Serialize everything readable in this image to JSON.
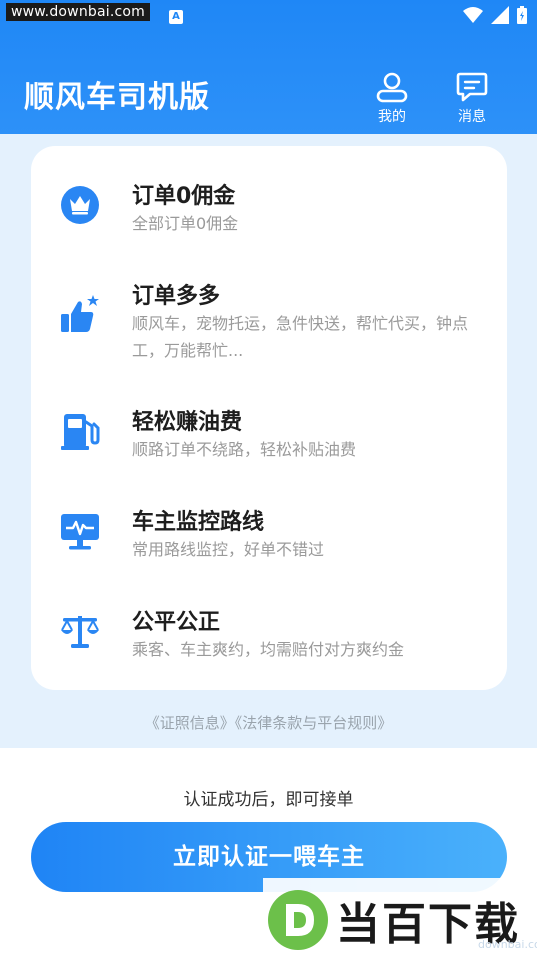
{
  "status_bar": {
    "watermark_url": "www.downbai.com",
    "badge": "A"
  },
  "header": {
    "title": "顺风车司机版",
    "mine_label": "我的",
    "messages_label": "消息"
  },
  "features": [
    {
      "title": "订单0佣金",
      "desc": "全部订单0佣金",
      "icon": "crown-icon"
    },
    {
      "title": "订单多多",
      "desc": "顺风车，宠物托运，急件快送，帮忙代买，钟点工，万能帮忙...",
      "icon": "thumbs-up-star-icon"
    },
    {
      "title": "轻松赚油费",
      "desc": "顺路订单不绕路，轻松补贴油费",
      "icon": "fuel-pump-icon"
    },
    {
      "title": "车主监控路线",
      "desc": "常用路线监控，好单不错过",
      "icon": "monitor-pulse-icon"
    },
    {
      "title": "公平公正",
      "desc": "乘客、车主爽约，均需赔付对方爽约金",
      "icon": "scale-icon"
    }
  ],
  "links": {
    "license": "《证照信息》",
    "legal": "《法律条款与平台规则》"
  },
  "hint": "认证成功后，即可接单",
  "cta_label": "立即认证一喂车主",
  "watermark": {
    "brand": "当百下载",
    "sub": "downbai.com"
  },
  "colors": {
    "primary": "#1f87f6",
    "background": "#e4f1fd"
  }
}
